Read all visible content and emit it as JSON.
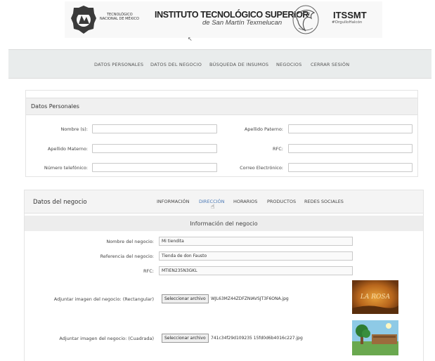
{
  "header": {
    "tnm_line1": "TECNOLÓGICO",
    "tnm_line2": "NACIONAL DE MÉXICO",
    "title": "INSTITUTO TECNOLÓGICO SUPERIOR",
    "subtitle": "de San Martín Texmelucan",
    "acronym": "ITSSMT",
    "hashtag": "#OrgulloHalcón"
  },
  "nav": {
    "items": [
      "DATOS PERSONALES",
      "DATOS DEL NEGOCIO",
      "BÚSQUEDA DE INSUMOS",
      "NEGOCIOS",
      "CERRAR SESIÓN"
    ]
  },
  "personal": {
    "title": "Datos Personales",
    "fields": {
      "nombre": {
        "label": "Nombre (s):",
        "value": ""
      },
      "paterno": {
        "label": "Apellido Paterno:",
        "value": ""
      },
      "materno": {
        "label": "Apellido Materno:",
        "value": ""
      },
      "rfc": {
        "label": "RFC:",
        "value": ""
      },
      "telefono": {
        "label": "Número telefónico:",
        "value": ""
      },
      "correo": {
        "label": "Correo Electrónico:",
        "value": ""
      }
    }
  },
  "business": {
    "title": "Datos del negocio",
    "tabs": [
      "INFORMACIÓN",
      "DIRECCIÓN",
      "HORARIOS",
      "PRODUCTOS",
      "REDES SOCIALES"
    ],
    "active_tab": "DIRECCIÓN",
    "section_title": "Información del negocio",
    "fields": {
      "nombre": {
        "label": "Nombre del negocio:",
        "value": "Mi tiendita"
      },
      "referencia": {
        "label": "Referencia del negocio:",
        "value": "Tienda de  don Fausto"
      },
      "rfc": {
        "label": "RFC:",
        "value": "MTIEN235N3GKL"
      }
    },
    "uploads": {
      "rect": {
        "label": "Adjuntar imagen del negocio: (Rectangular)",
        "button": "Seleccionar archivo",
        "filename": "WJL63MZ44ZDFZNIAVSJT3F6ONA.jpg"
      },
      "square": {
        "label": "Adjuntar imagen del negocio: (Cuadrada)",
        "button": "Seleccionar archivo",
        "filename": "741c34f29d109235 15fd0d6b4016c227.jpg"
      }
    },
    "preview_rect_text": "LA ROSA"
  },
  "colors": {
    "nav_bg": "#e9ecec",
    "active_tab": "#4a78b5"
  }
}
